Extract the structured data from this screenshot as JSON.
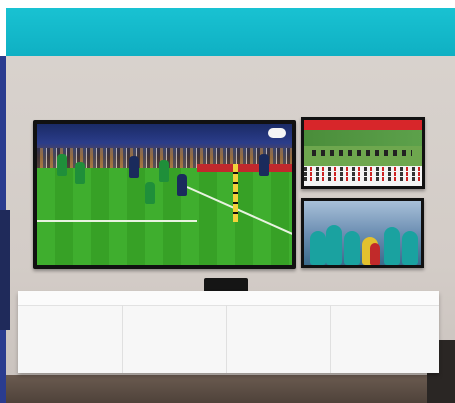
{
  "scene": {
    "description_tags": [
      "wall-mounted-tvs",
      "floating-media-cabinet"
    ],
    "colors": {
      "banner": "#15bccc",
      "wall": "#d6d0cb",
      "cabinet": "#f7f7f7",
      "pitch_green": "#3fae2e"
    }
  }
}
